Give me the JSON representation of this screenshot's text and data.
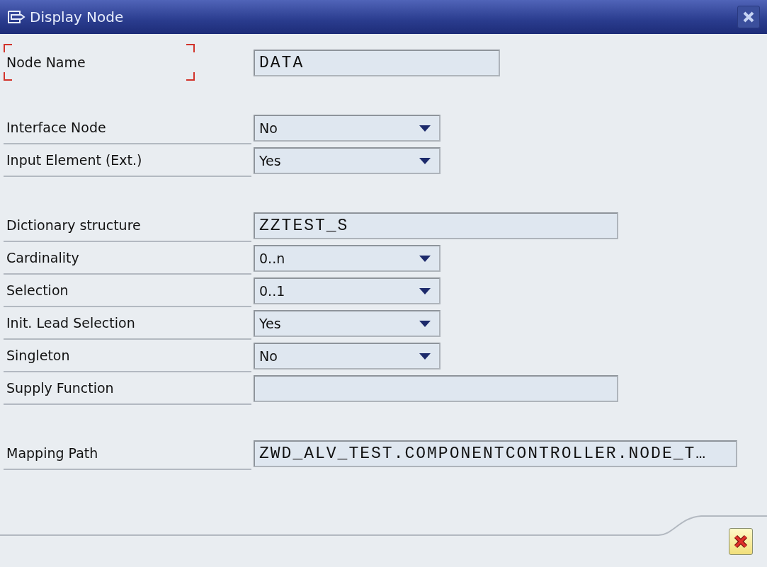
{
  "window": {
    "title": "Display Node"
  },
  "groups": [
    [
      {
        "label": "Node Name",
        "focused": true,
        "kind": "short_text",
        "value": "DATA"
      }
    ],
    [
      {
        "label": "Interface Node",
        "focused": false,
        "kind": "dropdown",
        "value": "No"
      },
      {
        "label": "Input Element (Ext.)",
        "focused": false,
        "kind": "dropdown",
        "value": "Yes"
      }
    ],
    [
      {
        "label": "Dictionary structure",
        "focused": false,
        "kind": "text",
        "value": "ZZTEST_S"
      },
      {
        "label": "Cardinality",
        "focused": false,
        "kind": "dropdown",
        "value": "0..n"
      },
      {
        "label": "Selection",
        "focused": false,
        "kind": "dropdown",
        "value": "0..1"
      },
      {
        "label": "Init. Lead Selection",
        "focused": false,
        "kind": "dropdown",
        "value": "Yes"
      },
      {
        "label": "Singleton",
        "focused": false,
        "kind": "dropdown",
        "value": "No"
      },
      {
        "label": "Supply Function",
        "focused": false,
        "kind": "text"
      }
    ],
    [
      {
        "label": "Mapping Path",
        "focused": false,
        "kind": "long_text",
        "value": "ZWD_ALV_TEST.COMPONENTCONTROLLER.NODE_T…"
      }
    ]
  ]
}
